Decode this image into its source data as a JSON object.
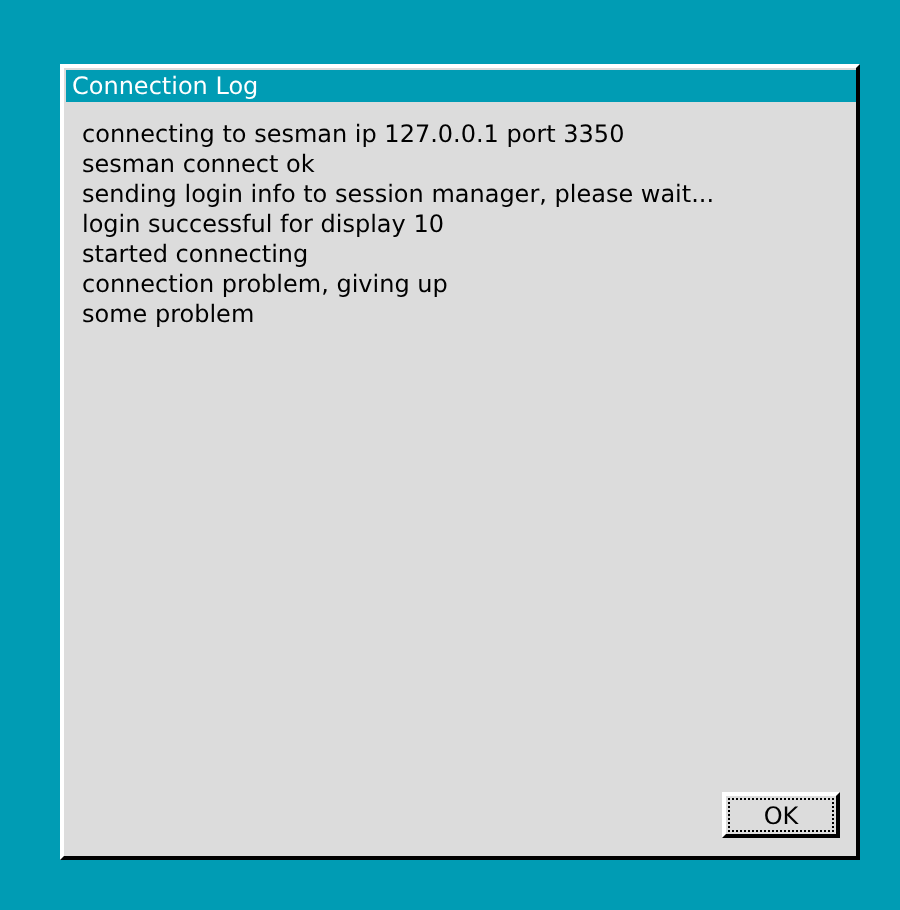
{
  "window": {
    "title": "Connection Log"
  },
  "log_lines": [
    "connecting to sesman ip 127.0.0.1 port 3350",
    "sesman connect ok",
    "sending login info to session manager, please wait...",
    "login successful for display 10",
    "started connecting",
    "connection problem, giving up",
    "some problem"
  ],
  "buttons": [
    {
      "label": "OK",
      "focused": true
    }
  ]
}
